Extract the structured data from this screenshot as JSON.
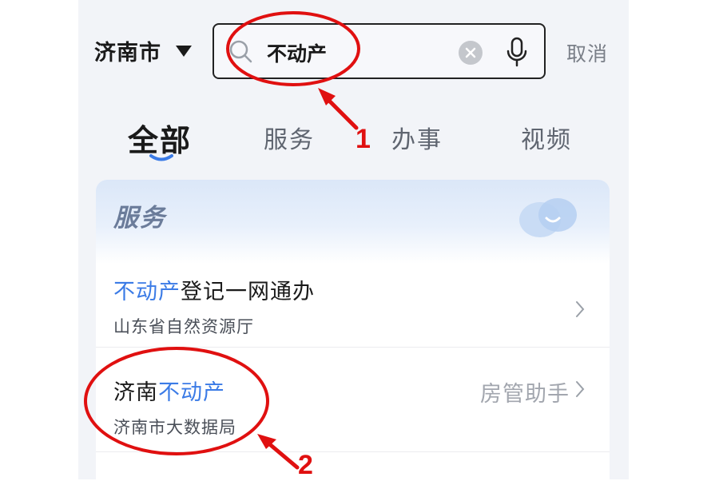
{
  "header": {
    "city": "济南市",
    "search_query": "不动产",
    "cancel_label": "取消"
  },
  "tabs": [
    {
      "label": "全部",
      "active": true
    },
    {
      "label": "服务",
      "active": false
    },
    {
      "label": "办事",
      "active": false
    },
    {
      "label": "视频",
      "active": false
    }
  ],
  "section": {
    "title": "服务",
    "items": [
      {
        "title_highlight": "不动产",
        "title_rest": "登记一网通办",
        "subtitle": "山东省自然资源厅",
        "tag": ""
      },
      {
        "title_prefix": "济南",
        "title_highlight": "不动产",
        "subtitle": "济南市大数据局",
        "tag": "房管助手"
      }
    ]
  },
  "annotations": [
    {
      "label": "1"
    },
    {
      "label": "2"
    }
  ],
  "colors": {
    "highlight": "#3b7be6",
    "annotation": "#e01010"
  }
}
